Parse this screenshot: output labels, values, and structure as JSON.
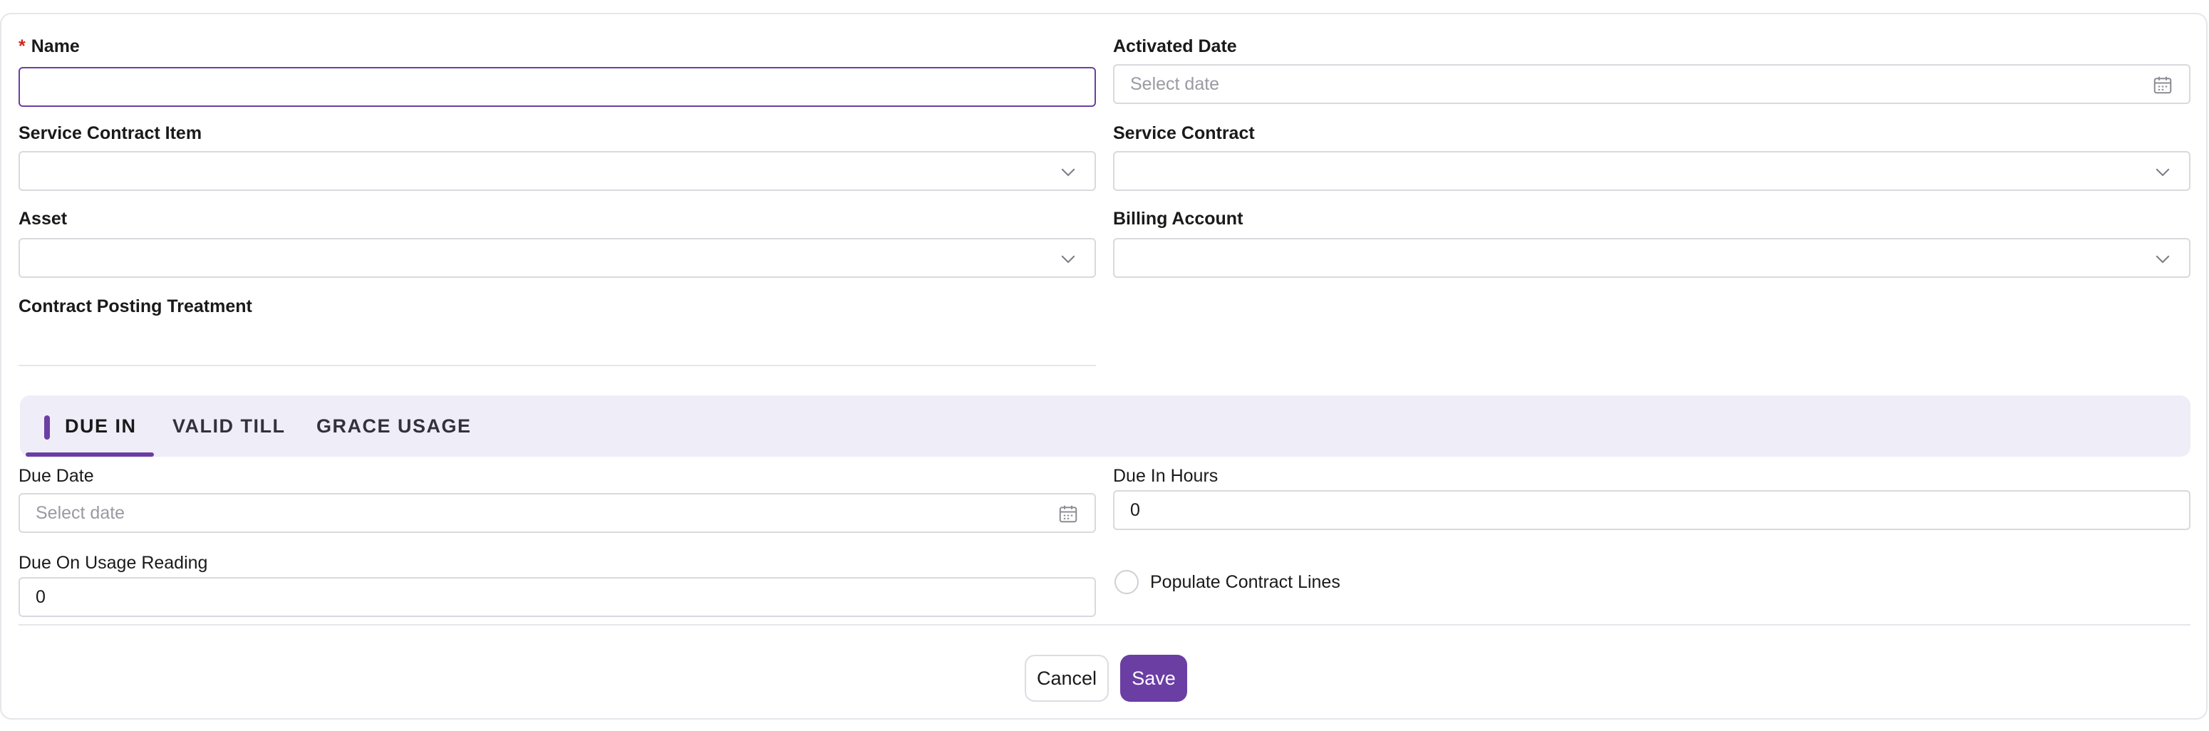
{
  "colors": {
    "accent": "#6b3ea4",
    "required": "#d0251c",
    "tab_bar_bg": "#efedf7"
  },
  "form": {
    "name": {
      "label": "Name",
      "required_mark": "*",
      "value": ""
    },
    "activated_date": {
      "label": "Activated Date",
      "placeholder": "Select date",
      "icon": "calendar-icon"
    },
    "service_contract_item": {
      "label": "Service Contract Item",
      "value": "",
      "icon": "chevron-down-icon"
    },
    "service_contract": {
      "label": "Service Contract",
      "value": "",
      "icon": "chevron-down-icon"
    },
    "asset": {
      "label": "Asset",
      "value": "",
      "icon": "chevron-down-icon"
    },
    "billing_account": {
      "label": "Billing Account",
      "value": "",
      "icon": "chevron-down-icon"
    },
    "contract_posting_treatment": {
      "label": "Contract Posting Treatment",
      "value": ""
    }
  },
  "tabs": [
    {
      "label": "DUE IN",
      "active": true
    },
    {
      "label": "VALID TILL",
      "active": false
    },
    {
      "label": "GRACE USAGE",
      "active": false
    }
  ],
  "due_in": {
    "due_date": {
      "label": "Due Date",
      "placeholder": "Select date",
      "icon": "calendar-icon"
    },
    "due_in_hours": {
      "label": "Due In Hours",
      "value": "0"
    },
    "due_on_usage_reading": {
      "label": "Due On Usage Reading",
      "value": "0"
    },
    "populate_contract_lines": {
      "label": "Populate Contract Lines",
      "checked": false
    }
  },
  "actions": {
    "cancel_label": "Cancel",
    "save_label": "Save"
  }
}
